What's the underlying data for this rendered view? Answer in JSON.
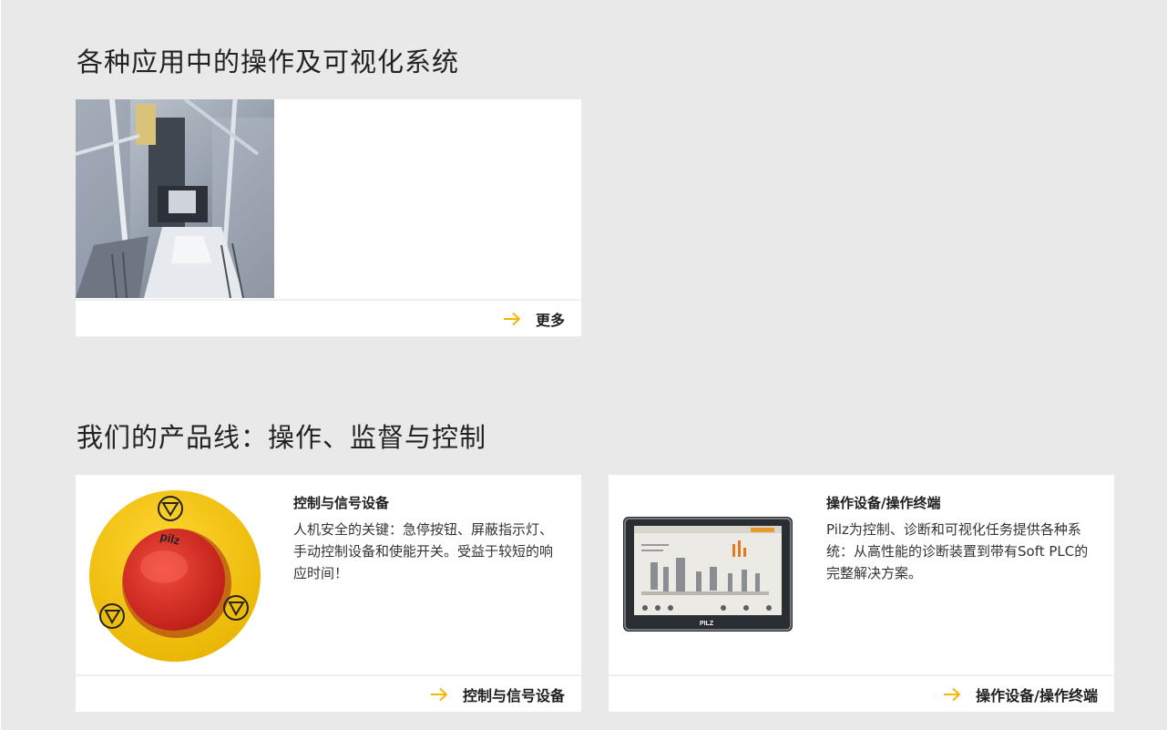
{
  "sections": {
    "applications_title": "各种应用中的操作及可视化系统",
    "product_lines_title": "我们的产品线：操作、监督与控制"
  },
  "application_card": {
    "more_label": "更多"
  },
  "products": [
    {
      "title": "控制与信号设备",
      "description": "人机安全的关键：急停按钮、屏蔽指示灯、手动控制设备和使能开关。受益于较短的响应时间！",
      "link_label": "控制与信号设备"
    },
    {
      "title": "操作设备/操作终端",
      "description": "Pilz为控制、诊断和可视化任务提供各种系统：从高性能的诊断装置到带有Soft PLC的完整解决方案。",
      "link_label": "操作设备/操作终端"
    }
  ],
  "estop_brand": "pilz",
  "panel_brand": "PILZ",
  "colors": {
    "page_bg": "#e9e9e9",
    "card_bg": "#ffffff",
    "accent_arrow": "#f2b800",
    "estop_yellow": "#f4c400",
    "estop_red": "#d9261c"
  },
  "icons": [
    "arrow-right-icon"
  ]
}
